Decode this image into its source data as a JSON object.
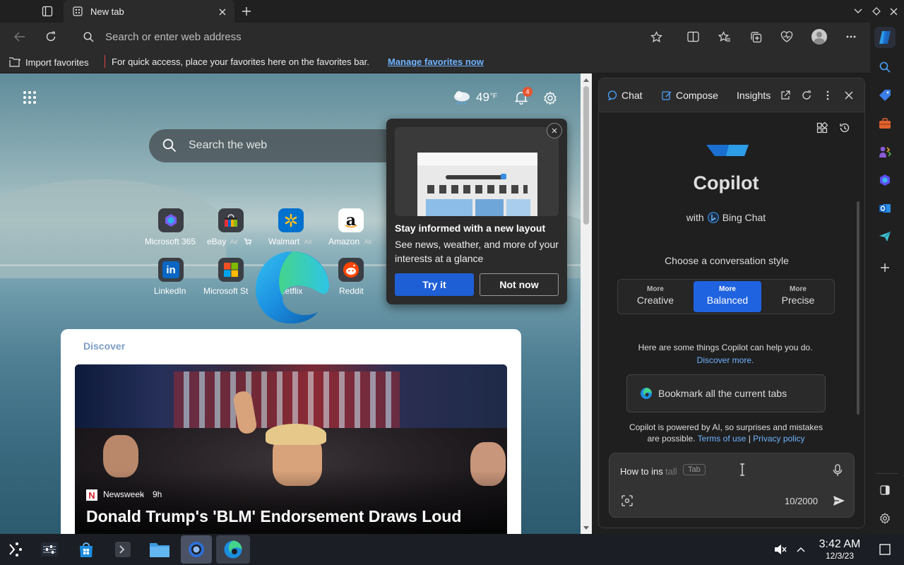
{
  "browser": {
    "tab_title": "New tab",
    "address_placeholder": "Search or enter web address",
    "favorites_bar": {
      "import_label": "Import favorites",
      "message": "For quick access, place your favorites here on the favorites bar.",
      "manage_link": "Manage favorites now"
    }
  },
  "newtab": {
    "weather_temp": "49",
    "weather_unit": "°F",
    "notification_count": "4",
    "search_placeholder": "Search the web",
    "quick_links": [
      {
        "label": "Microsoft 365",
        "ad": ""
      },
      {
        "label": "eBay",
        "ad": "Ad"
      },
      {
        "label": "Walmart",
        "ad": "Ad"
      },
      {
        "label": "Amazon",
        "ad": "Ad"
      },
      {
        "label": "LinkedIn",
        "ad": ""
      },
      {
        "label": "Microsoft St",
        "ad": ""
      },
      {
        "label": "Netflix",
        "ad": ""
      },
      {
        "label": "Reddit",
        "ad": ""
      }
    ],
    "popup": {
      "title": "Stay informed with a new layout",
      "body": "See news, weather, and more of your interests at a glance",
      "try_label": "Try it",
      "not_now_label": "Not now"
    },
    "discover_label": "Discover",
    "news": {
      "source": "Newsweek",
      "age": "9h",
      "headline": "Donald Trump's 'BLM' Endorsement Draws Loud"
    }
  },
  "copilot": {
    "tabs": [
      "Chat",
      "Compose",
      "Insights"
    ],
    "title": "Copilot",
    "with_label": "with",
    "bing_label": "Bing Chat",
    "style_prompt": "Choose a conversation style",
    "styles": [
      {
        "small": "More",
        "label": "Creative"
      },
      {
        "small": "More",
        "label": "Balanced"
      },
      {
        "small": "More",
        "label": "Precise"
      }
    ],
    "help_text": "Here are some things Copilot can help you do.",
    "discover_more": "Discover more.",
    "suggestion": "Bookmark all the current tabs",
    "disclaimer": "Copilot is powered by AI, so surprises and mistakes are possible.",
    "terms": "Terms of use",
    "separator": "|",
    "privacy": "Privacy policy",
    "input_typed": "How to ins",
    "input_ghost": "tall",
    "tab_hint": "Tab",
    "counter": "10/2000"
  },
  "taskbar": {
    "time": "3:42 AM",
    "date": "12/3/23"
  },
  "colors": {
    "accent": "#1f5fd6",
    "link": "#6fb3ff",
    "badge": "#e8542f"
  }
}
